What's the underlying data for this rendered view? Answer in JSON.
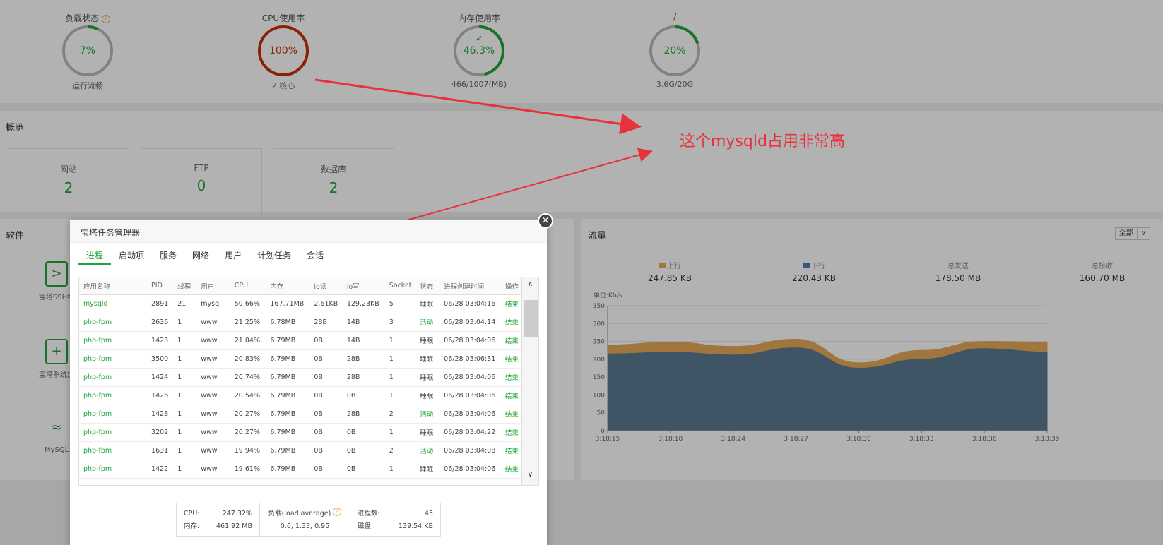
{
  "gauges": [
    {
      "title": "负载状态",
      "value": "7%",
      "sub": "运行流畅",
      "percent": 0.07,
      "color": "#20a53a",
      "help_icon": "help-icon"
    },
    {
      "title": "CPU使用率",
      "value": "100%",
      "sub": "2 核心",
      "percent": 1.0,
      "color": "#c9300c"
    },
    {
      "title": "内存使用率",
      "value": "46.3%",
      "sub": "466/1007(MB)",
      "percent": 0.463,
      "color": "#20a53a",
      "icon": "rocket-icon"
    },
    {
      "title": "/",
      "value": "20%",
      "sub": "3.6G/20G",
      "percent": 0.2,
      "color": "#20a53a"
    }
  ],
  "overview": {
    "title": "概览",
    "cards": [
      {
        "label": "网站",
        "value": "2"
      },
      {
        "label": "FTP",
        "value": "0"
      },
      {
        "label": "数据库",
        "value": "2"
      }
    ]
  },
  "software": {
    "title": "软件",
    "items": [
      {
        "label": "宝塔SSH终",
        "icon": "terminal-icon"
      },
      {
        "label": "宝塔系统加",
        "icon": "shield-icon"
      },
      {
        "label": "MySQL",
        "icon": "dolphin-icon"
      }
    ]
  },
  "traffic": {
    "title": "流量",
    "select": "全部",
    "stats": [
      {
        "label": "上行",
        "value": "247.85 KB"
      },
      {
        "label": "下行",
        "value": "220.43 KB"
      },
      {
        "label": "总发送",
        "value": "178.50 MB"
      },
      {
        "label": "总接收",
        "value": "160.70 MB"
      }
    ]
  },
  "chart_data": {
    "type": "area",
    "ylabel": "单位:Kb/s",
    "ylim": [
      0,
      350
    ],
    "yticks": [
      "0",
      "50",
      "100",
      "150",
      "200",
      "250",
      "300",
      "350"
    ],
    "x": [
      "3:18:15",
      "3:18:18",
      "3:18:24",
      "3:18:27",
      "3:18:30",
      "3:18:33",
      "3:18:36",
      "3:18:39"
    ],
    "series": [
      {
        "name": "下行",
        "values": [
          215,
          220,
          212,
          232,
          175,
          200,
          230,
          220
        ],
        "color": "#5b7a91"
      },
      {
        "name": "上行",
        "values": [
          240,
          248,
          236,
          256,
          190,
          225,
          250,
          248
        ],
        "color": "#e6a85a"
      }
    ]
  },
  "dialog": {
    "title": "宝塔任务管理器",
    "tabs": [
      "进程",
      "启动项",
      "服务",
      "网络",
      "用户",
      "计划任务",
      "会话"
    ],
    "columns": [
      "应用名称",
      "PID",
      "线程",
      "用户",
      "CPU",
      "内存",
      "io读",
      "io写",
      "Socket",
      "状态",
      "进程创建时间",
      "操作"
    ],
    "rows": [
      [
        "mysqld",
        "2891",
        "21",
        "mysql",
        "50.66%",
        "167.71MB",
        "2.61KB",
        "129.23KB",
        "5",
        "睡眠",
        "06/28 03:04:16",
        "结束"
      ],
      [
        "php-fpm",
        "2636",
        "1",
        "www",
        "21.25%",
        "6.78MB",
        "28B",
        "14B",
        "3",
        "活动",
        "06/28 03:04:14",
        "结束"
      ],
      [
        "php-fpm",
        "1423",
        "1",
        "www",
        "21.04%",
        "6.79MB",
        "0B",
        "14B",
        "1",
        "睡眠",
        "06/28 03:04:06",
        "结束"
      ],
      [
        "php-fpm",
        "3500",
        "1",
        "www",
        "20.83%",
        "6.79MB",
        "0B",
        "28B",
        "1",
        "睡眠",
        "06/28 03:06:31",
        "结束"
      ],
      [
        "php-fpm",
        "1424",
        "1",
        "www",
        "20.74%",
        "6.79MB",
        "0B",
        "28B",
        "1",
        "睡眠",
        "06/28 03:04:06",
        "结束"
      ],
      [
        "php-fpm",
        "1426",
        "1",
        "www",
        "20.54%",
        "6.79MB",
        "0B",
        "0B",
        "1",
        "睡眠",
        "06/28 03:04:06",
        "结束"
      ],
      [
        "php-fpm",
        "1428",
        "1",
        "www",
        "20.27%",
        "6.79MB",
        "0B",
        "28B",
        "2",
        "活动",
        "06/28 03:04:06",
        "结束"
      ],
      [
        "php-fpm",
        "3202",
        "1",
        "www",
        "20.27%",
        "6.79MB",
        "0B",
        "0B",
        "1",
        "睡眠",
        "06/28 03:04:22",
        "结束"
      ],
      [
        "php-fpm",
        "1631",
        "1",
        "www",
        "19.94%",
        "6.79MB",
        "0B",
        "0B",
        "2",
        "活动",
        "06/28 03:04:08",
        "结束"
      ],
      [
        "php-fpm",
        "1422",
        "1",
        "www",
        "19.61%",
        "6.79MB",
        "0B",
        "0B",
        "1",
        "睡眠",
        "06/28 03:04:06",
        "结束"
      ]
    ],
    "summary": {
      "cpu_label": "CPU:",
      "cpu_value": "247.32%",
      "mem_label": "内存:",
      "mem_value": "461.92 MB",
      "load_label": "负载(load average)",
      "load_value": "0.6, 1.33, 0.95",
      "proc_label": "进程数:",
      "proc_value": "45",
      "disk_label": "磁盘:",
      "disk_value": "139.54 KB"
    }
  },
  "annotation": "这个mysqld占用非常高"
}
